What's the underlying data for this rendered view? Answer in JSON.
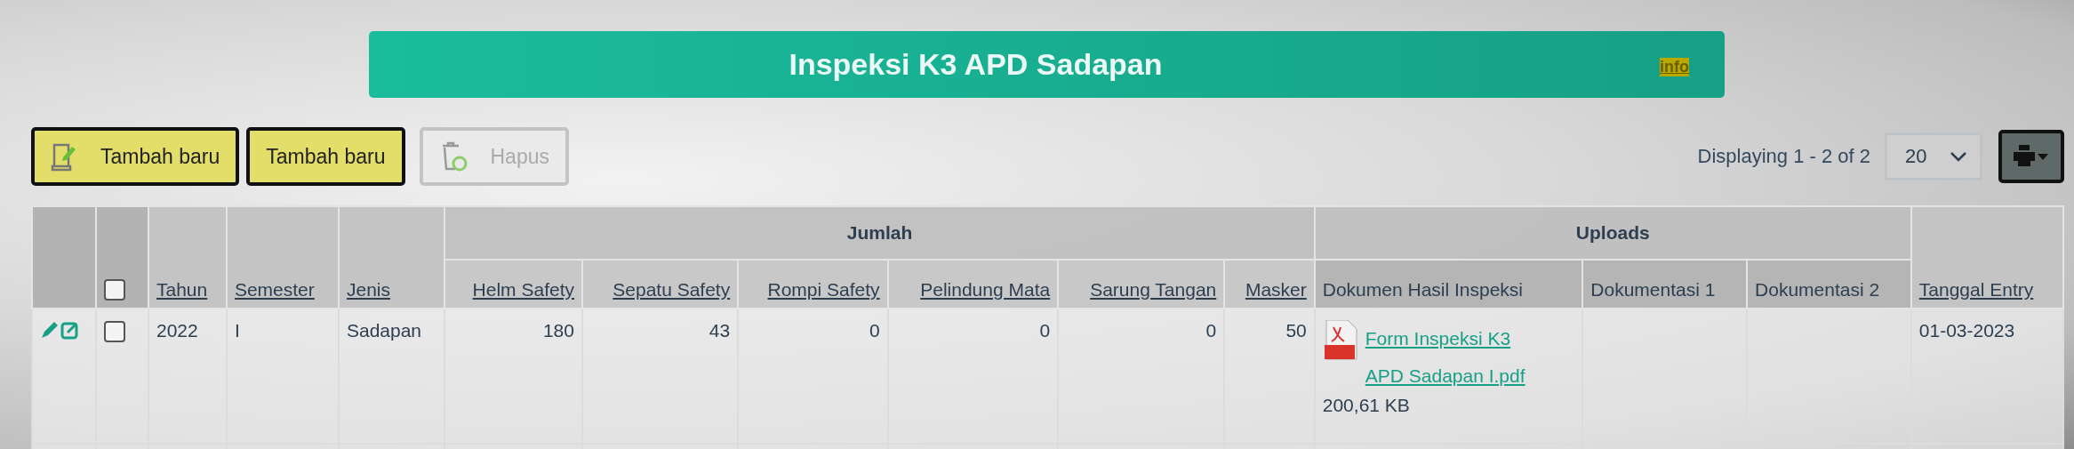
{
  "header": {
    "title": "Inspeksi K3 APD Sadapan",
    "info_link": "info"
  },
  "toolbar": {
    "buttons": [
      {
        "label": "Tambah baru",
        "kind": "add_icon",
        "disabled": false
      },
      {
        "label": "Tambah baru",
        "kind": "plain",
        "disabled": false
      },
      {
        "label": "Hapus",
        "kind": "delete_icon",
        "disabled": true
      }
    ],
    "display_text": "Displaying 1 - 2 of 2",
    "page_size": "20"
  },
  "table": {
    "columns": [
      {
        "kind": "actions"
      },
      {
        "kind": "select",
        "checked": false
      },
      {
        "kind": "field",
        "label": "Tahun",
        "sortable": true
      },
      {
        "kind": "field",
        "label": "Semester",
        "sortable": true
      },
      {
        "kind": "field",
        "label": "Jenis",
        "sortable": true
      },
      {
        "kind": "group",
        "label": "Jumlah",
        "colspan": 6,
        "children": [
          {
            "label": "Helm Safety",
            "sortable": true
          },
          {
            "label": "Sepatu Safety",
            "sortable": true
          },
          {
            "label": "Rompi Safety",
            "sortable": true
          },
          {
            "label": "Pelindung Mata",
            "sortable": true
          },
          {
            "label": "Sarung Tangan",
            "sortable": true
          },
          {
            "label": "Masker",
            "sortable": true
          }
        ]
      },
      {
        "kind": "group",
        "label": "Uploads",
        "colspan": 3,
        "children": [
          {
            "label": "Dokumen Hasil Inspeksi",
            "sortable": false
          },
          {
            "label": "Dokumentasi 1",
            "sortable": false
          },
          {
            "label": "Dokumentasi 2",
            "sortable": false
          }
        ]
      },
      {
        "kind": "field",
        "label": "Tanggal Entry",
        "sortable": true
      }
    ],
    "rows": [
      {
        "cells": [
          {
            "kind": "actions"
          },
          {
            "kind": "checkbox",
            "checked": false
          },
          {
            "kind": "text",
            "text": "2022"
          },
          {
            "kind": "text",
            "text": "I"
          },
          {
            "kind": "text",
            "text": "Sadapan"
          },
          {
            "kind": "number",
            "text": "180"
          },
          {
            "kind": "number",
            "text": "43"
          },
          {
            "kind": "number",
            "text": "0"
          },
          {
            "kind": "number",
            "text": "0"
          },
          {
            "kind": "number",
            "text": "0"
          },
          {
            "kind": "number",
            "text": "50"
          },
          {
            "kind": "file",
            "link": "Form Inspeksi K3 APD Sadapan I.pdf",
            "size": "200,61 KB"
          },
          {
            "kind": "empty"
          },
          {
            "kind": "empty"
          },
          {
            "kind": "text",
            "text": "01-03-2023"
          }
        ]
      }
    ]
  }
}
